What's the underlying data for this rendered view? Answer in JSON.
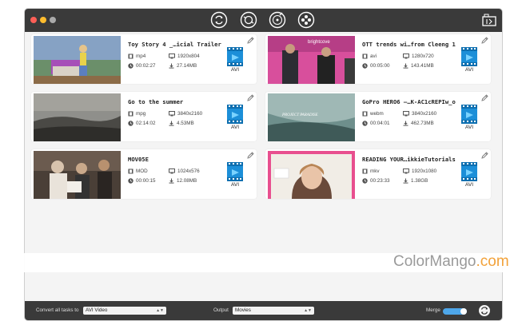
{
  "colors": {
    "titlebar": "#3a3a3a",
    "accent": "#4ea7ea",
    "brand_orange": "#f2a23a"
  },
  "toolbar": {
    "icons": [
      "convert-icon",
      "compress-icon",
      "burn-disc-icon",
      "download-reel-icon",
      "toolbox-icon"
    ]
  },
  "videos": [
    {
      "title": "Toy Story 4 _…icial Trailer",
      "format": "mp4",
      "resolution": "1920x804",
      "duration": "00:02:27",
      "size": "27.14MB",
      "output": "AVI"
    },
    {
      "title": "OTT trends wi…from Cleeng 1",
      "format": "avi",
      "resolution": "1280x720",
      "duration": "00:05:00",
      "size": "143.41MB",
      "output": "AVI"
    },
    {
      "title": "Go to the summer",
      "format": "mpg",
      "resolution": "3840x2160",
      "duration": "02:14:02",
      "size": "4.53MB",
      "output": "AVI"
    },
    {
      "title": "GoPro HERO6 —…K-AC1cREPIw_o",
      "format": "webm",
      "resolution": "3840x2160",
      "duration": "00:04:01",
      "size": "462.73MB",
      "output": "AVI"
    },
    {
      "title": "MOV05E",
      "format": "MOD",
      "resolution": "1024x576",
      "duration": "00:00:15",
      "size": "12.08MB",
      "output": "AVI"
    },
    {
      "title": "READING YOUR…ikkieTutorials",
      "format": "mkv",
      "resolution": "1920x1080",
      "duration": "00:23:33",
      "size": "1.38GB",
      "output": "AVI"
    }
  ],
  "thumb_text": {
    "brightcove": "brightcove",
    "gopro": "PROJECT PARADISE"
  },
  "bottom": {
    "convert_all_label": "Convert all tasks to",
    "convert_all_value": "AVI Video",
    "output_label": "Output",
    "output_value": "Movies",
    "merge_label": "Merge"
  },
  "watermark": {
    "part1": "ColorMango",
    "part2": ".com"
  }
}
